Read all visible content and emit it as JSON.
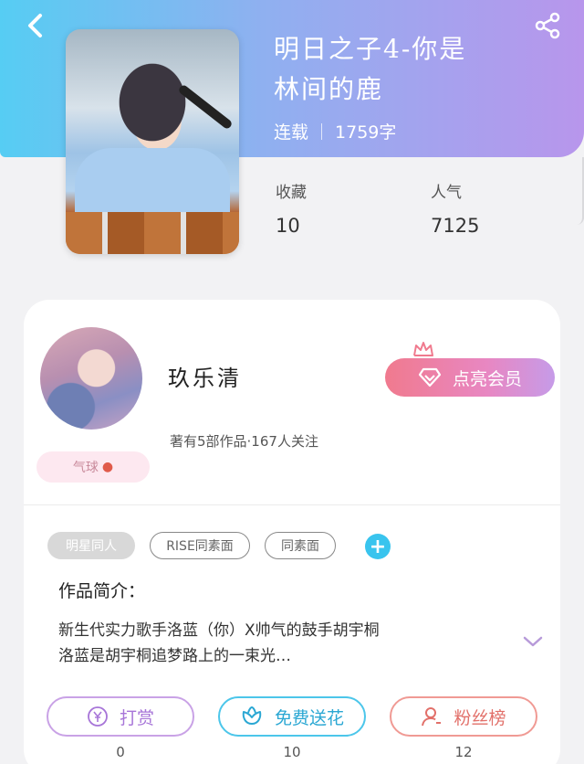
{
  "header": {
    "title_line1": "明日之子4-你是",
    "title_line2": "林间的鹿",
    "status": "连载",
    "word_count": "1759字"
  },
  "stats": {
    "favorites_label": "收藏",
    "favorites_value": "10",
    "popularity_label": "人气",
    "popularity_value": "7125"
  },
  "author": {
    "name": "玖乐清",
    "description": "著有5部作品·167人关注",
    "badge_text": "气球",
    "vip_button": "点亮会员"
  },
  "tags": [
    "明星同人",
    "RISE同素面",
    "同素面"
  ],
  "intro": {
    "title": "作品简介：",
    "line1": "新生代实力歌手洛蓝（你）X帅气的鼓手胡宇桐",
    "line2": "洛蓝是胡宇桐追梦路上的一束光…"
  },
  "actions": [
    {
      "label": "打赏",
      "count": "0"
    },
    {
      "label": "免费送花",
      "count": "10"
    },
    {
      "label": "粉丝榜",
      "count": "12"
    }
  ],
  "colors": {
    "header_gradient_start": "#56cdf3",
    "header_gradient_end": "#b896ec",
    "vip_gradient_start": "#f07a8e",
    "vip_gradient_end": "#c69be8",
    "plus_button": "#39c4ee"
  },
  "icons": {
    "back": "chevron-left-icon",
    "share": "share-icon",
    "diamond": "diamond-icon",
    "crown": "crown-icon",
    "plus": "plus-icon",
    "expand": "chevron-down-icon",
    "reward": "yen-icon",
    "flower": "flower-icon",
    "fans": "user-icon"
  }
}
